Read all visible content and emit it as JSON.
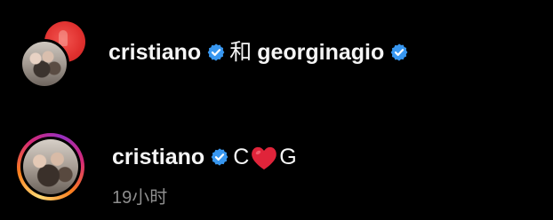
{
  "row1": {
    "username_a": "cristiano",
    "connector": "和",
    "username_b": "georginagio"
  },
  "row2": {
    "username": "cristiano",
    "caption_prefix": "C",
    "caption_suffix": "G",
    "timestamp": "19小时"
  },
  "colors": {
    "background": "#000000",
    "text": "#f5f5f5",
    "muted": "#8e8e8e",
    "verified": "#3897f0",
    "heart": "#e0243a"
  },
  "icons": {
    "verified": "verified-badge-icon",
    "heart": "red-heart-icon"
  }
}
